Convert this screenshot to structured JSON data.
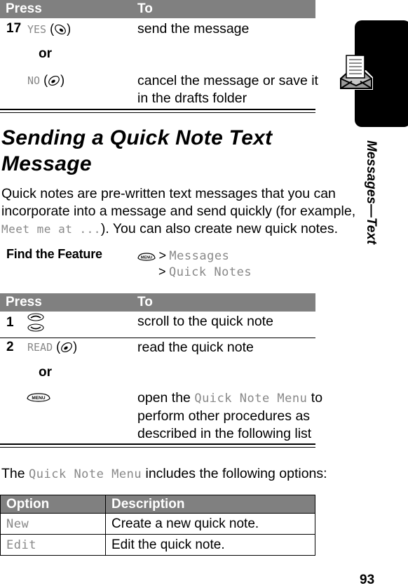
{
  "side_tab": {
    "section_label": "Messages—Text",
    "icon": "envelope-with-letter-icon"
  },
  "table1": {
    "header": {
      "press": "Press",
      "to": "To"
    },
    "step_number": "17",
    "rows": [
      {
        "key_label": "YES",
        "key_icon": "right-soft-key-icon",
        "action": "send the message"
      },
      {
        "connector": "or"
      },
      {
        "key_label": "NO",
        "key_icon": "left-soft-key-icon",
        "action_line1": "cancel the message or save it",
        "action_line2": "in the drafts folder"
      }
    ]
  },
  "section": {
    "title_line1": "Sending a Quick Note Text",
    "title_line2": "Message",
    "intro_line1": "Quick notes are pre-written text messages that you can",
    "intro_line2": "incorporate into a message and send quickly (for example,",
    "intro_example": "Meet me at ...",
    "intro_line3_rest": "). You can also create new quick notes."
  },
  "find_feature": {
    "label": "Find the Feature",
    "menu_key_icon": "menu-key-icon",
    "menu_key_text": "MENU",
    "separator": ">",
    "path": [
      "Messages",
      "Quick Notes"
    ]
  },
  "table2": {
    "header": {
      "press": "Press",
      "to": "To"
    },
    "steps": [
      {
        "number": "1",
        "key_icon": "scroll-up-down-icon",
        "action": "scroll to the quick note"
      },
      {
        "number": "2",
        "key_label": "READ",
        "key_icon": "left-soft-key-icon",
        "action": "read the quick note",
        "connector": "or",
        "alt_key_icon": "menu-key-icon",
        "alt_key_text": "MENU",
        "alt_action_prefix": "open the ",
        "alt_action_menu": "Quick Note Menu",
        "alt_action_suffix": " to",
        "alt_action_line2": "perform other procedures as",
        "alt_action_line3": "described in the following list"
      }
    ]
  },
  "menu_intro": {
    "prefix": "The ",
    "menu_name": "Quick Note Menu",
    "suffix": " includes the following options:"
  },
  "options_table": {
    "columns": [
      "Option",
      "Description"
    ],
    "rows": [
      {
        "option": "New",
        "description": "Create a new quick note."
      },
      {
        "option": "Edit",
        "description": "Edit the quick note."
      }
    ]
  },
  "page_number": "93",
  "colors": {
    "header_bg": "#808080",
    "display_text": "#888888",
    "tab_bg": "#000000"
  }
}
